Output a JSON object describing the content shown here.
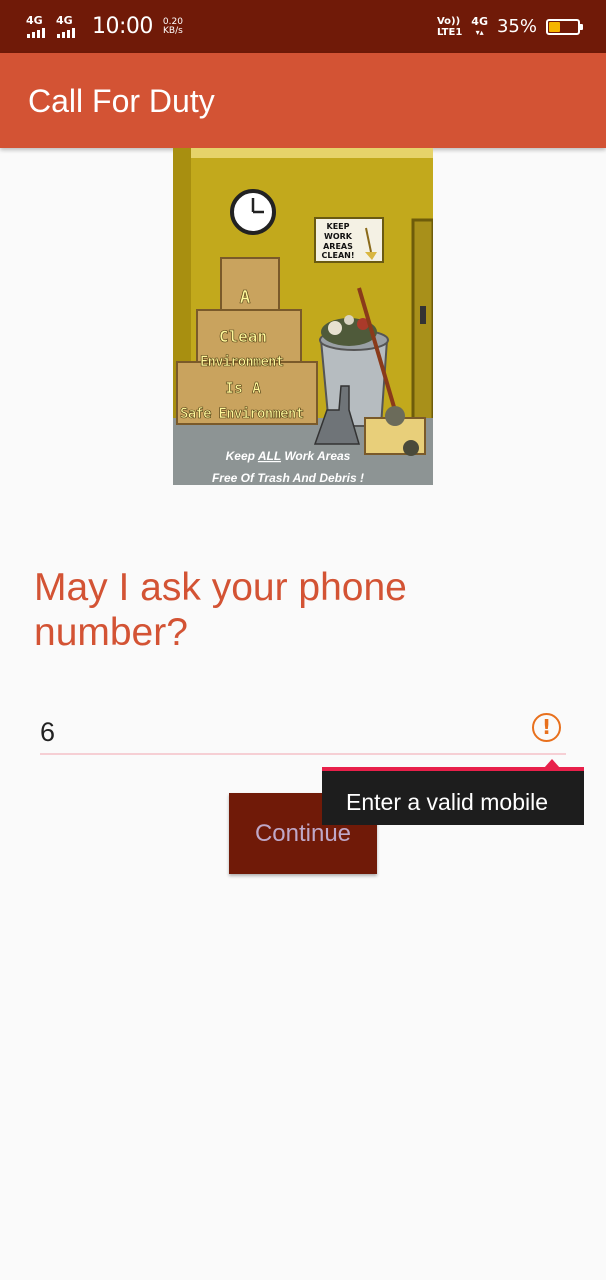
{
  "status_bar": {
    "sim1_network": "4G",
    "sim2_network": "4G",
    "time": "10:00",
    "speed_value": "0.20",
    "speed_unit": "KB/s",
    "volte_top": "Vo))",
    "volte_bottom": "LTE1",
    "net_right": "4G",
    "battery_percent": "35%",
    "battery_level": 0.35,
    "battery_color": "#f5b400"
  },
  "app_bar": {
    "title": "Call For Duty",
    "color": "#d35334"
  },
  "poster": {
    "sign_line1": "KEEP",
    "sign_line2": "WORK",
    "sign_line3": "AREAS",
    "sign_line4": "CLEAN!",
    "box_line1": "A",
    "box_line2": "Clean",
    "box_line3": "Environment",
    "box_line4": "Is A",
    "box_line5": "Safe Environment",
    "footer_line1_pre": "Keep ",
    "footer_line1_em": "ALL",
    "footer_line1_post": " Work Areas",
    "footer_line2": "Free Of Trash And Debris !"
  },
  "form": {
    "question": "May I ask your phone number?",
    "phone_value": "6",
    "error_icon": "error-exclamation-icon",
    "error_message": "Enter a valid mobile",
    "continue_label": "Continue",
    "accent_color": "#d35334",
    "error_color": "#e8204a"
  }
}
